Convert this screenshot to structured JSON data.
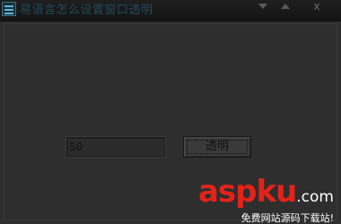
{
  "window": {
    "title": "易语言怎么设置窗口透明",
    "controls": {
      "minimize_icon": "triangle-down-icon",
      "maximize_icon": "triangle-up-icon",
      "close_label": "x"
    }
  },
  "form": {
    "transparency_input_value": "50",
    "transparent_button_label": "透明"
  },
  "watermark": {
    "logo": "aspku",
    "logo_suffix": ".com",
    "tagline": "免费网站源码下载站!",
    "brand_color": "#e2231a"
  }
}
